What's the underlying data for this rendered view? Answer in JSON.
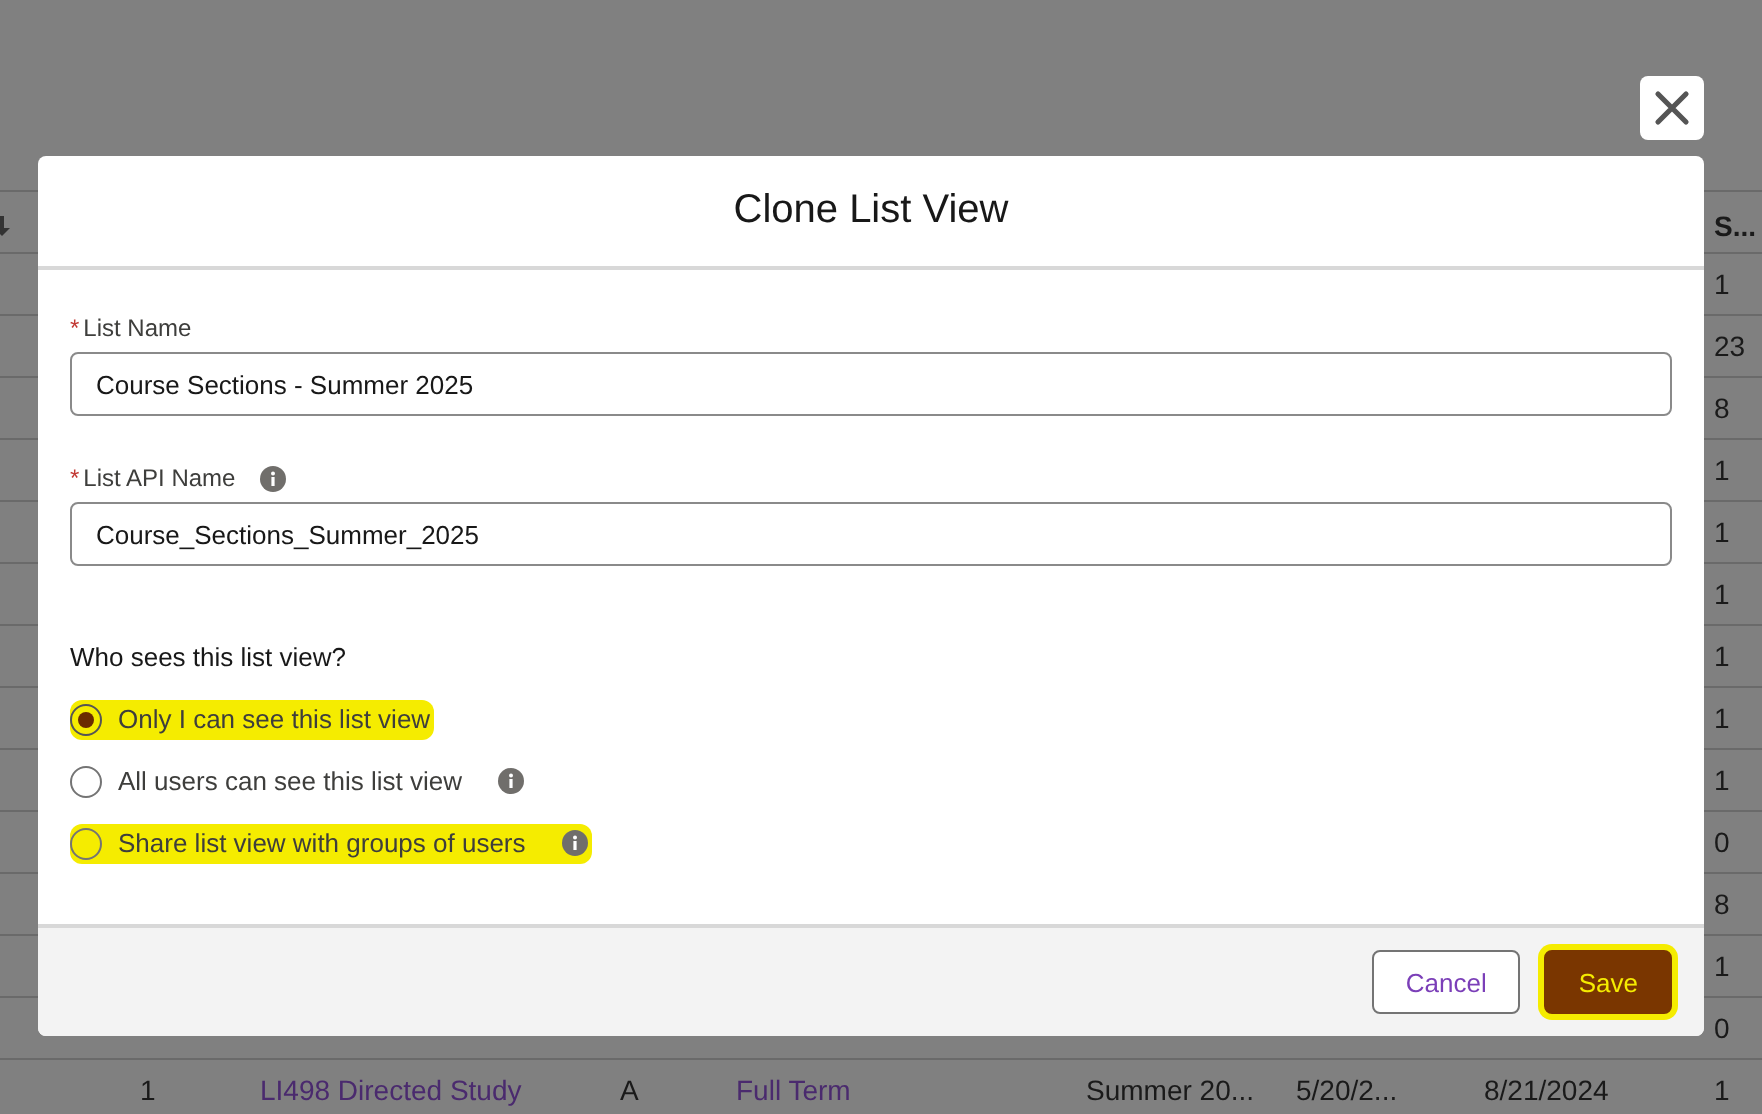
{
  "background_table": {
    "header": {
      "last_column": "S..."
    },
    "rows": [
      {
        "kind": "partial",
        "last": "1"
      },
      {
        "kind": "partial",
        "last": "23"
      },
      {
        "kind": "partial",
        "last": "8"
      },
      {
        "kind": "partial",
        "last": "1"
      },
      {
        "kind": "partial",
        "last": "1"
      },
      {
        "kind": "partial",
        "last": "1"
      },
      {
        "kind": "partial",
        "last": "1"
      },
      {
        "kind": "partial",
        "last": "1"
      },
      {
        "kind": "partial",
        "last": "1"
      },
      {
        "kind": "partial",
        "last": "0"
      },
      {
        "kind": "partial",
        "last": "8"
      },
      {
        "kind": "partial",
        "last": "1"
      },
      {
        "kind": "partial",
        "last": "0"
      },
      {
        "kind": "full",
        "cells": [
          {
            "text": "1",
            "link": false
          },
          {
            "text": "LI498 Directed Study",
            "link": true
          },
          {
            "text": "A",
            "link": false
          },
          {
            "text": "Full Term",
            "link": true
          },
          {
            "text": "Summer 20...",
            "link": false
          },
          {
            "text": "5/20/2...",
            "link": false
          },
          {
            "text": "8/21/2024",
            "link": false
          },
          {
            "text": "1",
            "link": false
          }
        ]
      }
    ]
  },
  "modal": {
    "title": "Clone List View",
    "fields": [
      {
        "required_marker": "*",
        "label": "List Name",
        "info": false,
        "value": "Course Sections - Summer 2025"
      },
      {
        "required_marker": "*",
        "label": "List API Name",
        "info": true,
        "value": "Course_Sections_Summer_2025"
      }
    ],
    "visibility": {
      "question": "Who sees this list view?",
      "options": [
        {
          "label": "Only I can see this list view",
          "selected": true,
          "info": false,
          "highlighted": true
        },
        {
          "label": "All users can see this list view",
          "selected": false,
          "info": true,
          "highlighted": false
        },
        {
          "label": "Share list view with groups of users",
          "selected": false,
          "info": true,
          "highlighted": true
        }
      ]
    },
    "buttons": [
      {
        "label": "Cancel",
        "kind": "neutral",
        "highlighted": false
      },
      {
        "label": "Save",
        "kind": "brand",
        "highlighted": true
      }
    ]
  }
}
